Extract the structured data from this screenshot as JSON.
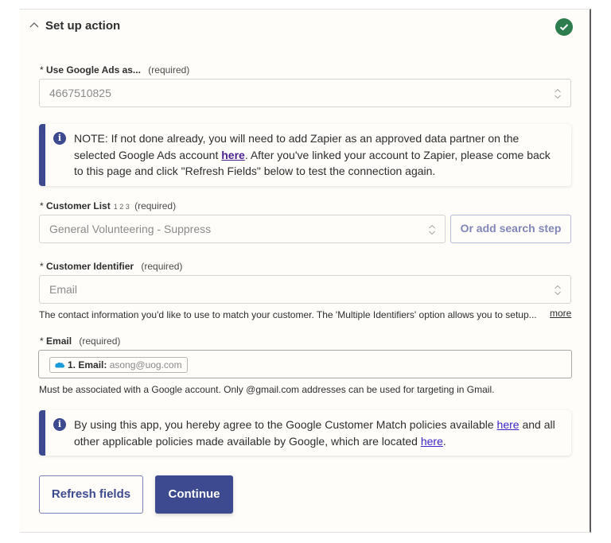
{
  "section": {
    "title": "Set up action",
    "status_icon": "check-circle-icon",
    "status_color": "#2e7d4f",
    "collapse_icon": "chevron-up-icon"
  },
  "fields": {
    "google_ads": {
      "asterisk": "*",
      "label": "Use Google Ads as...",
      "required": "(required)",
      "value": "4667510825"
    },
    "customer_list": {
      "asterisk": "*",
      "label": "Customer List",
      "hint": "1 2 3",
      "required": "(required)",
      "value": "General Volunteering - Suppress",
      "search_step_button": "Or add search step"
    },
    "customer_identifier": {
      "asterisk": "*",
      "label": "Customer Identifier",
      "required": "(required)",
      "value": "Email",
      "help": "The contact information you'd like to use to match your customer. The 'Multiple Identifiers' option allows you to setup...",
      "more_link": "more"
    },
    "email": {
      "asterisk": "*",
      "label": "Email",
      "required": "(required)",
      "pill_icon": "salesforce-cloud-icon",
      "pill_key": "1. Email:",
      "pill_value": "asong@uog.com",
      "help": "Must be associated with a Google account. Only @gmail.com addresses can be used for targeting in Gmail."
    }
  },
  "notes": {
    "partner": {
      "text_1": "NOTE: If not done already, you will need to add Zapier as an approved data partner on the selected Google Ads account ",
      "link": "here",
      "text_2": ". After you've linked your account to Zapier, please come back to this page and click \"Refresh Fields\" below to test the connection again."
    },
    "policy": {
      "text_1": "By using this app, you hereby agree to the Google Customer Match policies available ",
      "link_1": "here",
      "text_2": " and all other applicable policies made available by Google, which are located ",
      "link_2": "here",
      "text_3": "."
    }
  },
  "buttons": {
    "refresh": "Refresh fields",
    "continue": "Continue"
  },
  "colors": {
    "accent": "#3d4a8f",
    "success": "#2e7d4f",
    "panel_bg": "#fffdf9"
  }
}
